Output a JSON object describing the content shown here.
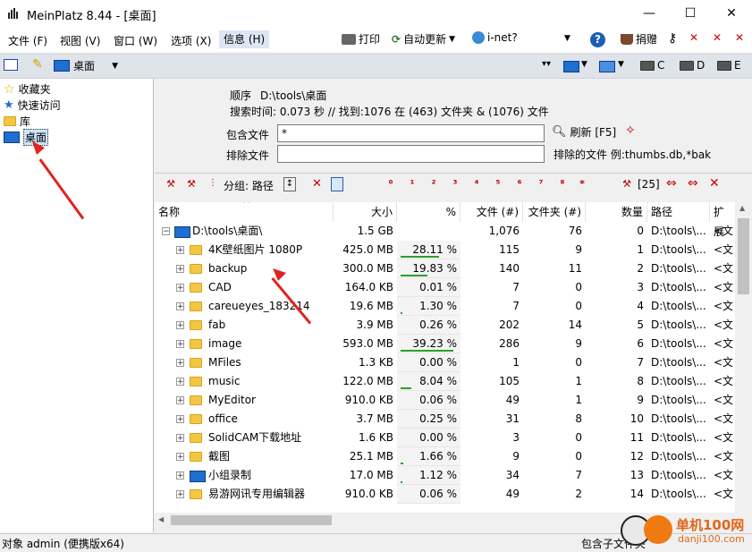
{
  "window": {
    "title": "MeinPlatz 8.44 - [桌面]",
    "min": "—",
    "max": "☐",
    "close": "✕"
  },
  "menu": [
    "文件 (F)",
    "视图 (V)",
    "窗口 (W)",
    "选项 (X)",
    "信息 (H)"
  ],
  "toolbar": {
    "print": "打印",
    "auto_update": "自动更新",
    "inet": "i-net?",
    "donate": "捐赠"
  },
  "address": {
    "current": "桌面",
    "drives": [
      "C",
      "D",
      "E"
    ]
  },
  "tree": [
    {
      "label": "收藏夹",
      "icon": "star-icon"
    },
    {
      "label": "快速访问",
      "icon": "pin-icon"
    },
    {
      "label": "库",
      "icon": "library-icon"
    },
    {
      "label": "桌面",
      "icon": "desktop-icon",
      "selected": true
    }
  ],
  "info": {
    "order_label": "顺序",
    "order_path": "D:\\tools\\桌面",
    "search_line": "搜索时间: 0.073 秒 //  找到:1076 在 (463) 文件夹 & (1076) 文件",
    "include_label": "包含文件",
    "include_value": "*",
    "exclude_label": "排除文件",
    "exclude_value": "",
    "refresh": "刷新 [F5]",
    "excluded_files": "排除的文件 例:thumbs.db,*bak"
  },
  "toolbar2": {
    "group_label": "分组: 路径",
    "count": "[25]"
  },
  "columns": [
    "名称",
    "大小",
    "%",
    "文件 (#)",
    "文件夹 (#)",
    "数量",
    "路径",
    "扩展"
  ],
  "root": {
    "name": "D:\\tools\\桌面\\",
    "size": "1.5 GB",
    "files": "1,076",
    "folders": "76",
    "count": "0",
    "path": "D:\\tools\\...",
    "ext": "<文"
  },
  "rows": [
    {
      "name": "4K壁纸图片 1080P",
      "size": "425.0 MB",
      "pct": "28.11 %",
      "pct_value": 28.11,
      "files": "115",
      "folders": "9",
      "count": "1",
      "path": "D:\\tools\\...",
      "ext": "<文",
      "icon": "folder"
    },
    {
      "name": "backup",
      "size": "300.0 MB",
      "pct": "19.83 %",
      "pct_value": 19.83,
      "files": "140",
      "folders": "11",
      "count": "2",
      "path": "D:\\tools\\...",
      "ext": "<文",
      "icon": "folder-net"
    },
    {
      "name": "CAD",
      "size": "164.0 KB",
      "pct": "0.01 %",
      "pct_value": 0.01,
      "files": "7",
      "folders": "0",
      "count": "3",
      "path": "D:\\tools\\...",
      "ext": "<文",
      "icon": "folder"
    },
    {
      "name": "careueyes_183214",
      "size": "19.6 MB",
      "pct": "1.30 %",
      "pct_value": 1.3,
      "files": "7",
      "folders": "0",
      "count": "4",
      "path": "D:\\tools\\...",
      "ext": "<文",
      "icon": "folder"
    },
    {
      "name": "fab",
      "size": "3.9 MB",
      "pct": "0.26 %",
      "pct_value": 0.26,
      "files": "202",
      "folders": "14",
      "count": "5",
      "path": "D:\\tools\\...",
      "ext": "<文",
      "icon": "folder"
    },
    {
      "name": "image",
      "size": "593.0 MB",
      "pct": "39.23 %",
      "pct_value": 39.23,
      "files": "286",
      "folders": "9",
      "count": "6",
      "path": "D:\\tools\\...",
      "ext": "<文",
      "icon": "folder"
    },
    {
      "name": "MFiles",
      "size": "1.3 KB",
      "pct": "0.00 %",
      "pct_value": 0.0,
      "files": "1",
      "folders": "0",
      "count": "7",
      "path": "D:\\tools\\...",
      "ext": "<文",
      "icon": "folder"
    },
    {
      "name": "music",
      "size": "122.0 MB",
      "pct": "8.04 %",
      "pct_value": 8.04,
      "files": "105",
      "folders": "1",
      "count": "8",
      "path": "D:\\tools\\...",
      "ext": "<文",
      "icon": "folder"
    },
    {
      "name": "MyEditor",
      "size": "910.0 KB",
      "pct": "0.06 %",
      "pct_value": 0.06,
      "files": "49",
      "folders": "1",
      "count": "9",
      "path": "D:\\tools\\...",
      "ext": "<文",
      "icon": "folder"
    },
    {
      "name": "office",
      "size": "3.7 MB",
      "pct": "0.25 %",
      "pct_value": 0.25,
      "files": "31",
      "folders": "8",
      "count": "10",
      "path": "D:\\tools\\...",
      "ext": "<文",
      "icon": "folder"
    },
    {
      "name": "SolidCAM下载地址",
      "size": "1.6 KB",
      "pct": "0.00 %",
      "pct_value": 0.0,
      "files": "3",
      "folders": "0",
      "count": "11",
      "path": "D:\\tools\\...",
      "ext": "<文",
      "icon": "folder"
    },
    {
      "name": "截图",
      "size": "25.1 MB",
      "pct": "1.66 %",
      "pct_value": 1.66,
      "files": "9",
      "folders": "0",
      "count": "12",
      "path": "D:\\tools\\...",
      "ext": "<文",
      "icon": "folder"
    },
    {
      "name": "小组录制",
      "size": "17.0 MB",
      "pct": "1.12 %",
      "pct_value": 1.12,
      "files": "34",
      "folders": "7",
      "count": "13",
      "path": "D:\\tools\\...",
      "ext": "<文",
      "icon": "monitor"
    },
    {
      "name": "易游网讯专用编辑器",
      "size": "910.0 KB",
      "pct": "0.06 %",
      "pct_value": 0.06,
      "files": "49",
      "folders": "2",
      "count": "14",
      "path": "D:\\tools\\...",
      "ext": "<文",
      "icon": "folder"
    }
  ],
  "status": {
    "left": "对象 admin (便携版x64)",
    "right": "包含子文件夹"
  },
  "watermark": {
    "name": "单机100网",
    "url": "danji100.com"
  }
}
